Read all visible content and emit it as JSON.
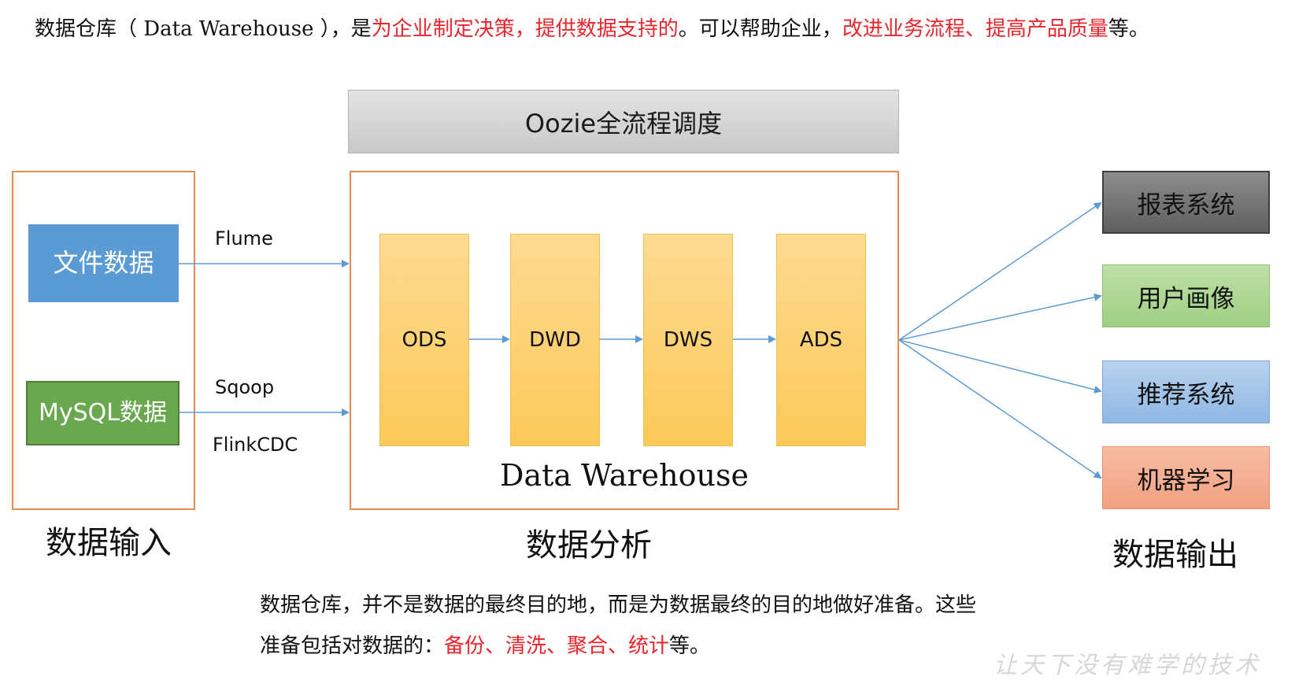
{
  "top_text": {
    "p1": "数据仓库（",
    "p2": " Data Warehouse ",
    "p3": "），是",
    "p4_red": "为企业制定决策，提供数据支持的",
    "p5": "。可以帮助企业，",
    "p6_red": "改进业务流程、提高产品质量",
    "p7": "等。"
  },
  "scheduler": {
    "label": "Oozie全流程调度"
  },
  "input": {
    "title": "数据输入",
    "sources": {
      "file": "文件数据",
      "mysql": "MySQL数据"
    },
    "edges": {
      "flume": "Flume",
      "sqoop": "Sqoop",
      "flinkcdc": "FlinkCDC"
    }
  },
  "warehouse": {
    "title": "Data Warehouse",
    "section_title": "数据分析",
    "layers": [
      "ODS",
      "DWD",
      "DWS",
      "ADS"
    ]
  },
  "output": {
    "title": "数据输出",
    "targets": [
      "报表系统",
      "用户画像",
      "推荐系统",
      "机器学习"
    ]
  },
  "bottom_text": {
    "line1": "数据仓库，并不是数据的最终目的地，而是为数据最终的目的地做好准备。这些",
    "line2_a": "准备包括对数据的：",
    "line2_red": "备份、清洗、聚合、统计",
    "line2_b": "等。"
  },
  "watermark": "让天下没有难学的技术",
  "colors": {
    "frame_orange": "#ef8a4c",
    "arrow_blue": "#5b9bd5",
    "highlight_red": "#e8262b",
    "layer_yellow": "#fbc958"
  }
}
